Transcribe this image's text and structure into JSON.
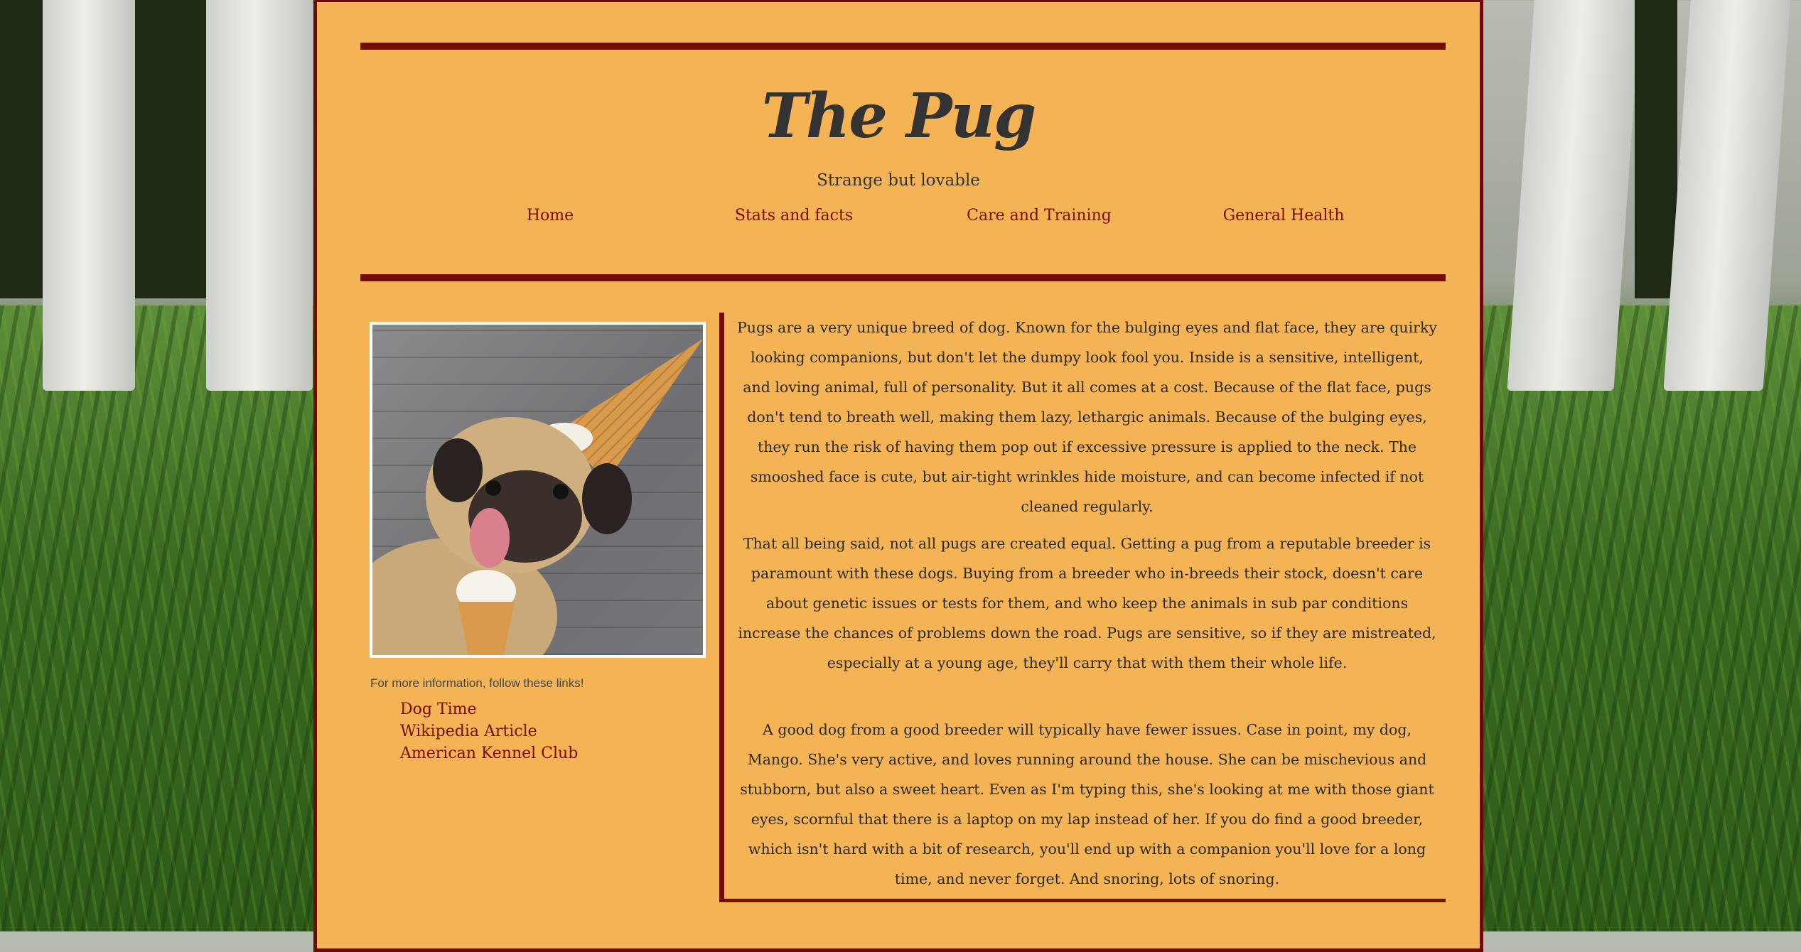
{
  "site": {
    "title": "The Pug",
    "subtitle": "Strange but lovable"
  },
  "nav": [
    {
      "label": "Home"
    },
    {
      "label": "Stats and facts"
    },
    {
      "label": "Care and Training"
    },
    {
      "label": "General Health"
    }
  ],
  "sidebar": {
    "image_alt": "Pug licking an ice cream cone with a cone on its head",
    "more_info": "For more information, follow these links!",
    "links": [
      {
        "label": "Dog Time"
      },
      {
        "label": "Wikipedia Article"
      },
      {
        "label": "American Kennel Club"
      }
    ]
  },
  "main": {
    "paragraphs": [
      "Pugs are a very unique breed of dog. Known for the bulging eyes and flat face, they are quirky looking companions, but don't let the dumpy look fool you. Inside is a sensitive, intelligent, and loving animal, full of personality. But it all comes at a cost. Because of the flat face, pugs don't tend to breath well, making them lazy, lethargic animals. Because of the bulging eyes, they run the risk of having them pop out if excessive pressure is applied to the neck. The smooshed face is cute, but air-tight wrinkles hide moisture, and can become infected if not cleaned regularly.",
      "That all being said, not all pugs are created equal. Getting a pug from a reputable breeder is paramount with these dogs. Buying from a breeder who in-breeds their stock, doesn't care about genetic issues or tests for them, and who keep the animals in sub par conditions increase the chances of problems down the road. Pugs are sensitive, so if they are mistreated, especially at a young age, they'll carry that with them their whole life.",
      "A good dog from a good breeder will typically have fewer issues. Case in point, my dog, Mango. She's very active, and loves running around the house. She can be mischevious and stubborn, but also a sweet heart. Even as I'm typing this, she's looking at me with those giant eyes, scornful that there is a laptop on my lap instead of her. If you do find a good breeder, which isn't hard with a bit of research, you'll end up with a companion you'll love for a long time, and never forget. And snoring, lots of snoring."
    ]
  },
  "colors": {
    "page_bg": "#f4b455",
    "accent": "#760c08",
    "link": "#7a0b05",
    "text": "#333333"
  }
}
